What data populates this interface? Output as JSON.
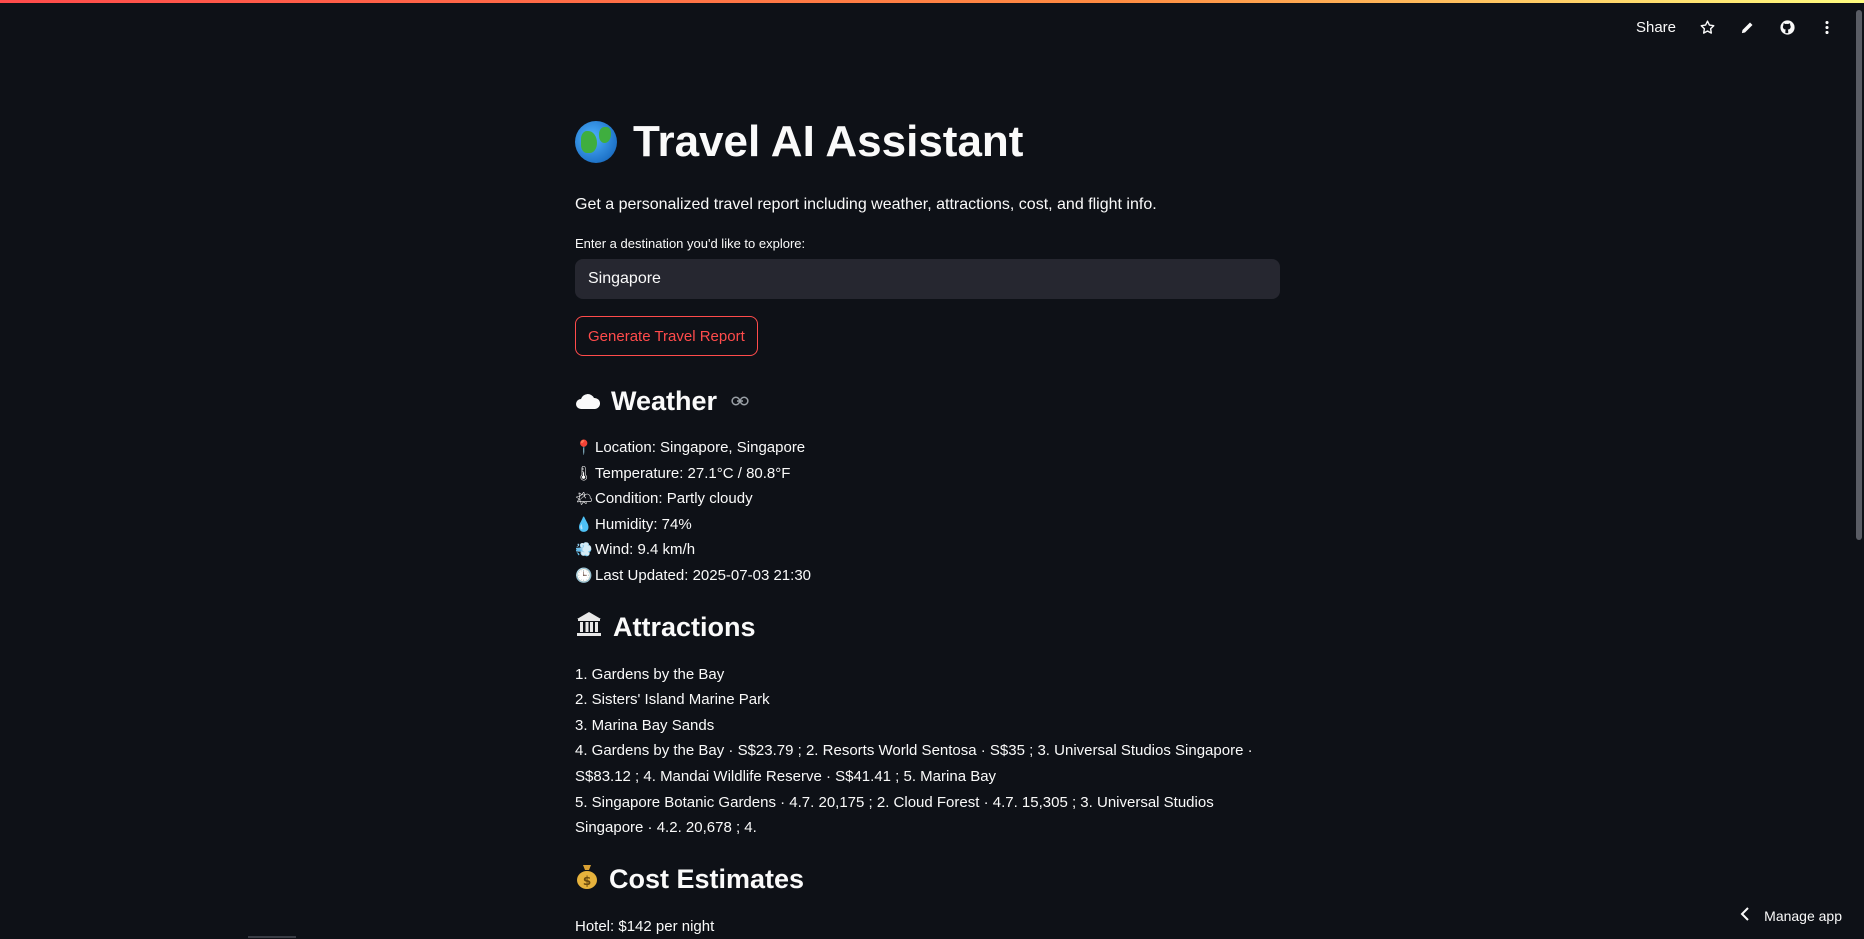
{
  "toolbar": {
    "share_label": "Share",
    "icons": [
      "star-icon",
      "pencil-icon",
      "github-icon",
      "more-vert-icon"
    ]
  },
  "app": {
    "title": "Travel AI Assistant",
    "subtitle": "Get a personalized travel report including weather, attractions, cost, and flight info.",
    "input_label": "Enter a destination you'd like to explore:",
    "destination_value": "Singapore",
    "generate_button": "Generate Travel Report"
  },
  "weather": {
    "heading": "Weather",
    "items": [
      {
        "icon": "📍",
        "text": "Location: Singapore, Singapore"
      },
      {
        "icon": "🌡",
        "text": "Temperature: 27.1°C / 80.8°F"
      },
      {
        "icon": "🌤",
        "text": "Condition: Partly cloudy"
      },
      {
        "icon": "💧",
        "text": "Humidity: 74%"
      },
      {
        "icon": "💨",
        "text": "Wind: 9.4 km/h"
      },
      {
        "icon": "🕒",
        "text": "Last Updated: 2025-07-03 21:30"
      }
    ]
  },
  "attractions": {
    "heading": "Attractions",
    "items": [
      "1. Gardens by the Bay",
      "2. Sisters' Island Marine Park",
      "3. Marina Bay Sands",
      "4. Gardens by the Bay · S$23.79 ; 2. Resorts World Sentosa · S$35 ; 3. Universal Studios Singapore · S$83.12 ; 4. Mandai Wildlife Reserve · S$41.41 ; 5. Marina Bay",
      "5. Singapore Botanic Gardens · 4.7. 20,175 ; 2. Cloud Forest · 4.7. 15,305 ; 3. Universal Studios Singapore · 4.2. 20,678 ; 4."
    ]
  },
  "cost": {
    "heading": "Cost Estimates",
    "hotel": "Hotel: $142 per night"
  },
  "footer": {
    "manage_label": "Manage app"
  },
  "colors": {
    "background": "#0e1117",
    "accent": "#ff4b4b",
    "input_bg": "#262730"
  }
}
